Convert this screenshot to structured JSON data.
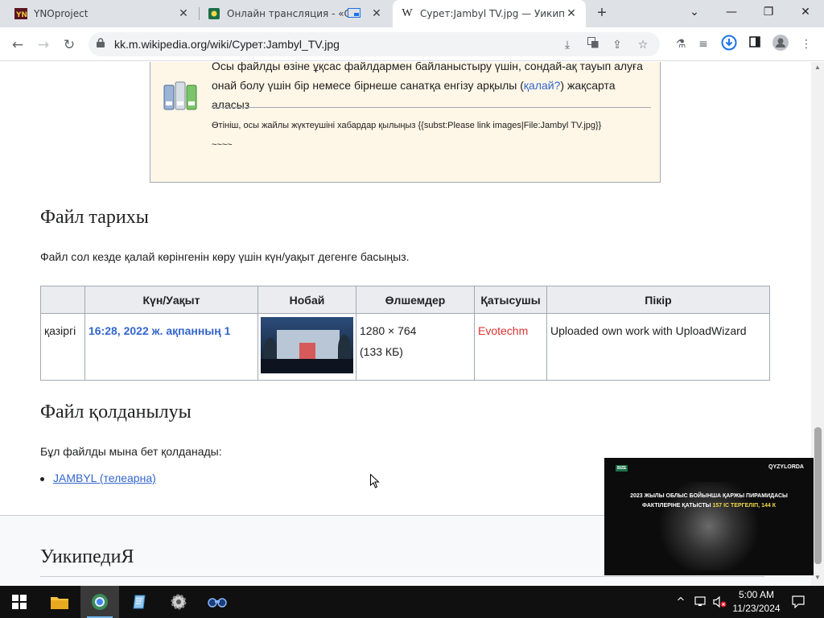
{
  "browser": {
    "tabs": [
      {
        "title": "YNOproject",
        "active": false
      },
      {
        "title": "Онлайн трансляция - «QYZ",
        "active": false
      },
      {
        "title": "Сурет:Jambyl TV.jpg — Уикипед",
        "active": true
      }
    ],
    "new_tab": "+",
    "url": "kk.m.wikipedia.org/wiki/Сурет:Jambyl_TV.jpg"
  },
  "notice": {
    "text_main": "Осы файлды өзіне ұқсас файлдармен байланыстыру үшін, сондай-ақ тауып алуға онай болу үшін бір немесе бірнеше санатқа енгізу арқылы (",
    "link": "қалай?",
    "text_after": ") жақсарта аласыз",
    "small": "Өтініш, осы жайлы жүктеушіні хабардар қылыңыз {{subst:Please link images|File:Jambyl TV.jpg}}",
    "signature": "~~~~"
  },
  "history": {
    "heading": "Файл тарихы",
    "intro": "Файл сол кезде қалай көрінгенін көру үшін күн/уақыт дегенге басыңыз.",
    "columns": [
      "",
      "Күн/Уақыт",
      "Нобай",
      "Өлшемдер",
      "Қатысушы",
      "Пікір"
    ],
    "row": {
      "current": "қазіргі",
      "datetime": "16:28, 2022 ж. ақпанның 1",
      "dimensions": "1280 × 764",
      "size": "(133 КБ)",
      "user": "Evotechm",
      "comment": "Uploaded own work with UploadWizard"
    }
  },
  "usage": {
    "heading": "Файл қолданылуы",
    "intro": "Бұл файлды мына бет қолданады:",
    "link": "JAMBYL (телеарна)"
  },
  "footer": {
    "brand": "УикипедиЯ"
  },
  "pip": {
    "tag": "BIZE",
    "brand": "QYZYLORDA",
    "line1": "2023 ЖЫЛЫ ОБЛЫС БОЙЫНША ҚАРЖЫ ПИРАМИДАСЫ",
    "line2_prefix": "ФАКТІЛЕРІНЕ ҚАТЫСТЫ ",
    "line2_highlight": "157 ІС ТЕРГЕЛІП, 144 К"
  },
  "taskbar": {
    "time": "5:00 AM",
    "date": "11/23/2024"
  },
  "colors": {
    "link": "#3366cc",
    "redlink": "#dd3333",
    "notice_bg": "#fef6e7",
    "table_header_bg": "#eaecf0"
  }
}
